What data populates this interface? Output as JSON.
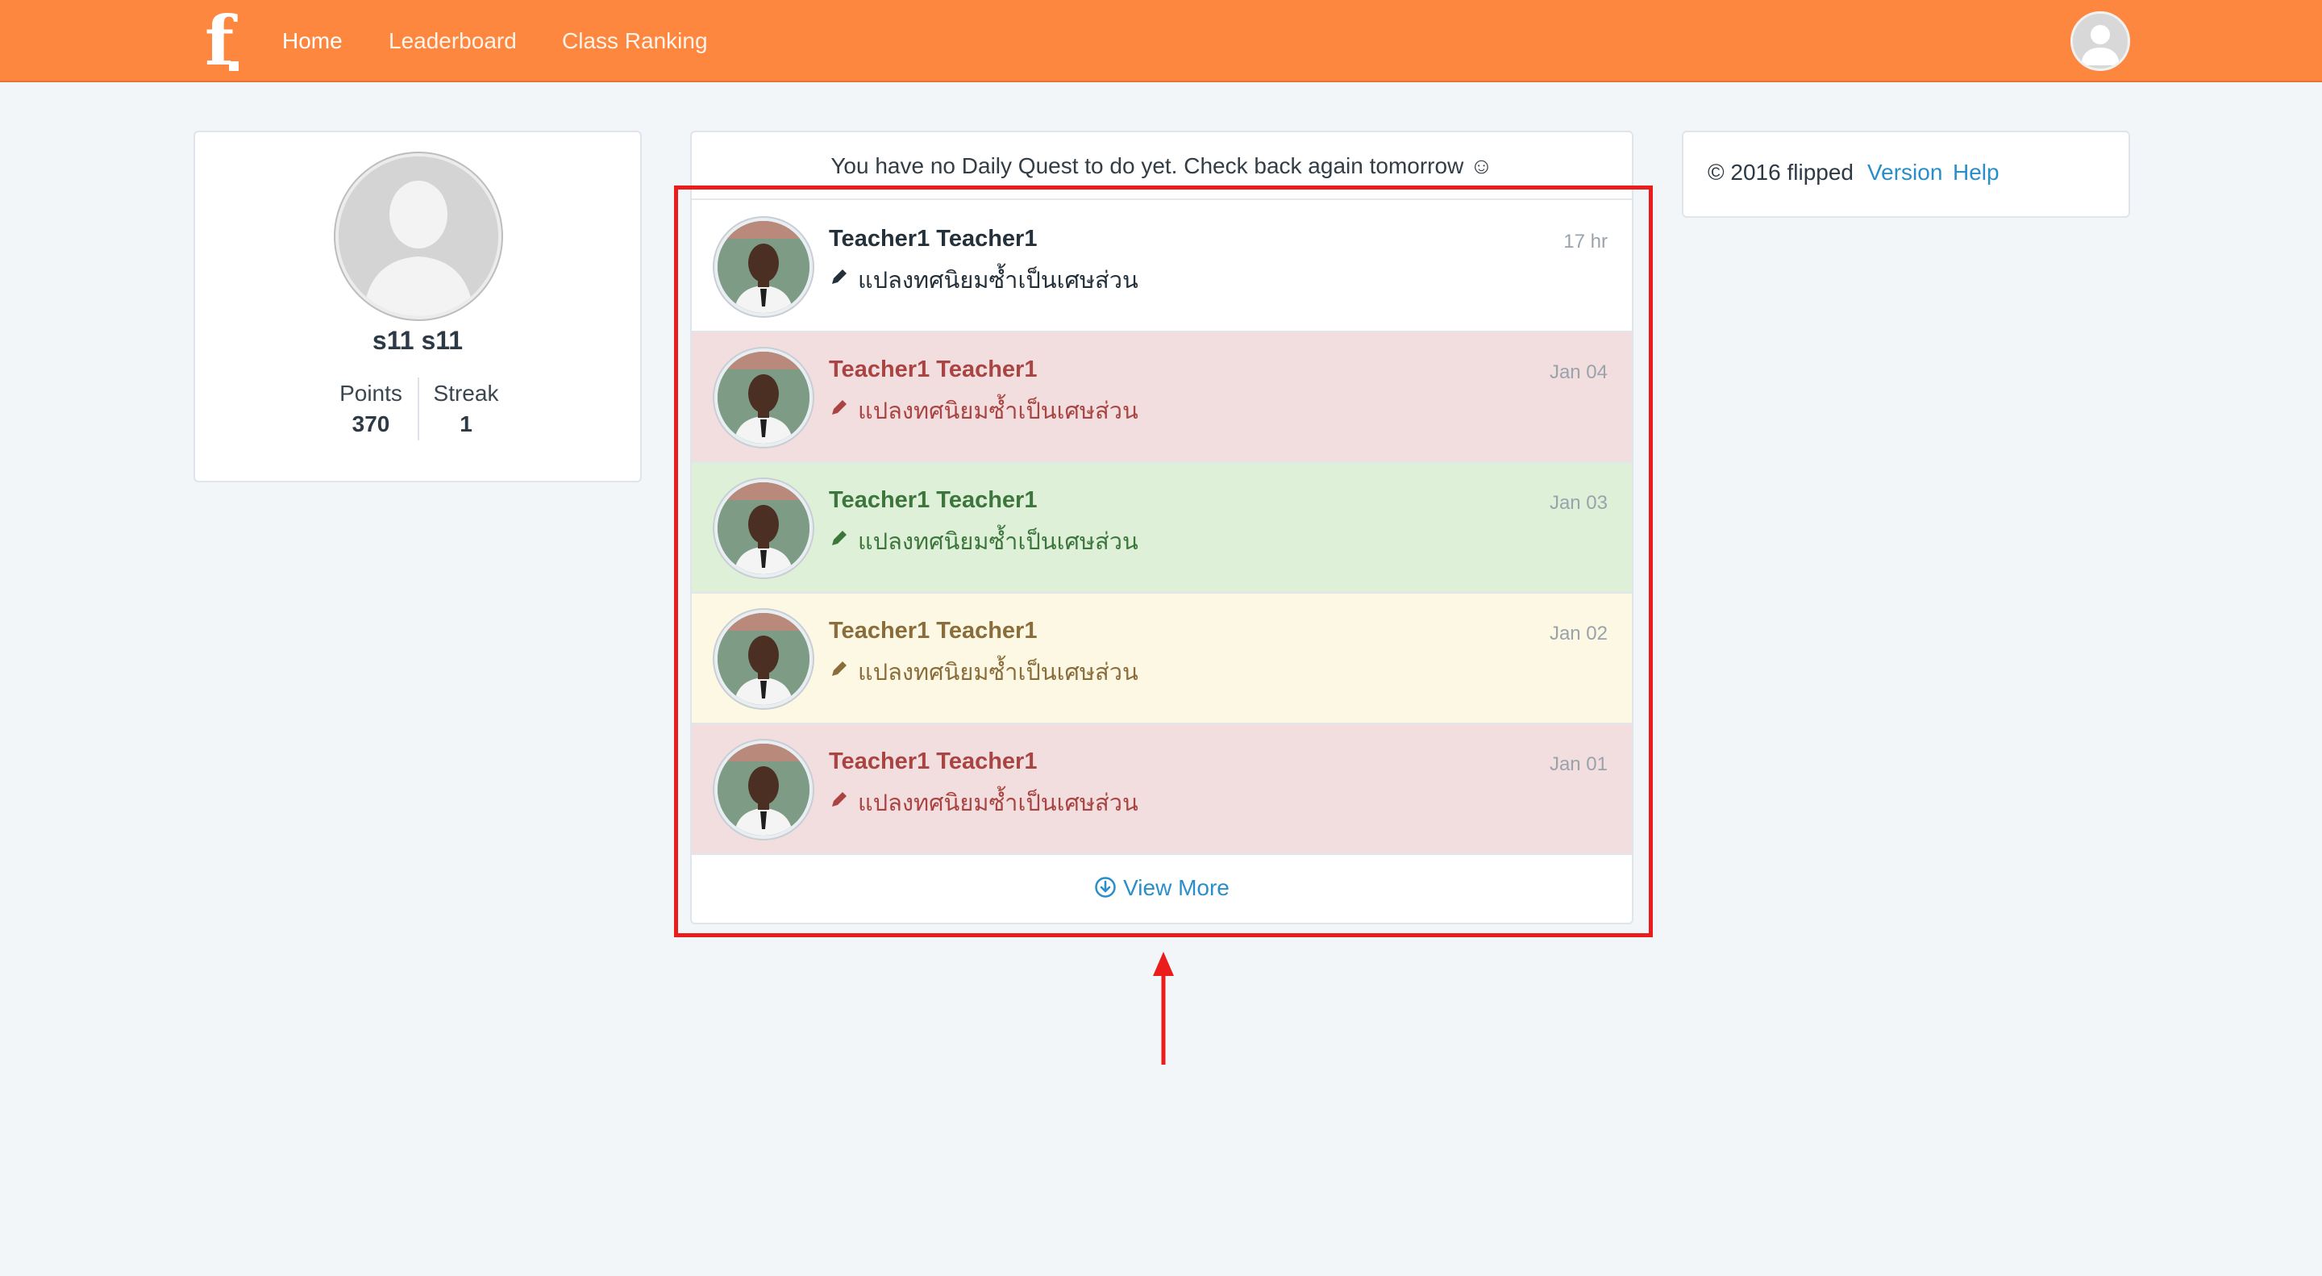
{
  "navbar": {
    "logo_letter": "f",
    "links": [
      {
        "label": "Home",
        "active": true
      },
      {
        "label": "Leaderboard",
        "active": false
      },
      {
        "label": "Class Ranking",
        "active": false
      }
    ]
  },
  "profile": {
    "name": "s11 s11",
    "points_label": "Points",
    "points_value": "370",
    "streak_label": "Streak",
    "streak_value": "1"
  },
  "feed": {
    "daily_quest_message": "You have no Daily Quest to do yet. Check back again tomorrow ☺",
    "items": [
      {
        "name": "Teacher1 Teacher1",
        "text": "แปลงทศนิยมซ้ำเป็นเศษส่วน",
        "time": "17 hr",
        "status": "neutral"
      },
      {
        "name": "Teacher1 Teacher1",
        "text": "แปลงทศนิยมซ้ำเป็นเศษส่วน",
        "time": "Jan 04",
        "status": "danger"
      },
      {
        "name": "Teacher1 Teacher1",
        "text": "แปลงทศนิยมซ้ำเป็นเศษส่วน",
        "time": "Jan 03",
        "status": "success"
      },
      {
        "name": "Teacher1 Teacher1",
        "text": "แปลงทศนิยมซ้ำเป็นเศษส่วน",
        "time": "Jan 02",
        "status": "warning"
      },
      {
        "name": "Teacher1 Teacher1",
        "text": "แปลงทศนิยมซ้ำเป็นเศษส่วน",
        "time": "Jan 01",
        "status": "danger"
      }
    ],
    "view_more_label": "View More",
    "icons": {
      "item": "pencil-icon",
      "view_more": "arrow-circle-down-icon"
    }
  },
  "footer": {
    "copyright": "© 2016 flipped",
    "version_label": "Version",
    "help_label": "Help"
  },
  "colors": {
    "navbar": "#fd873f",
    "link": "#2a8ec8",
    "danger": "#f2dede",
    "success": "#dff0d8",
    "warning": "#fcf8e3",
    "annotation": "#ea1c1c"
  }
}
